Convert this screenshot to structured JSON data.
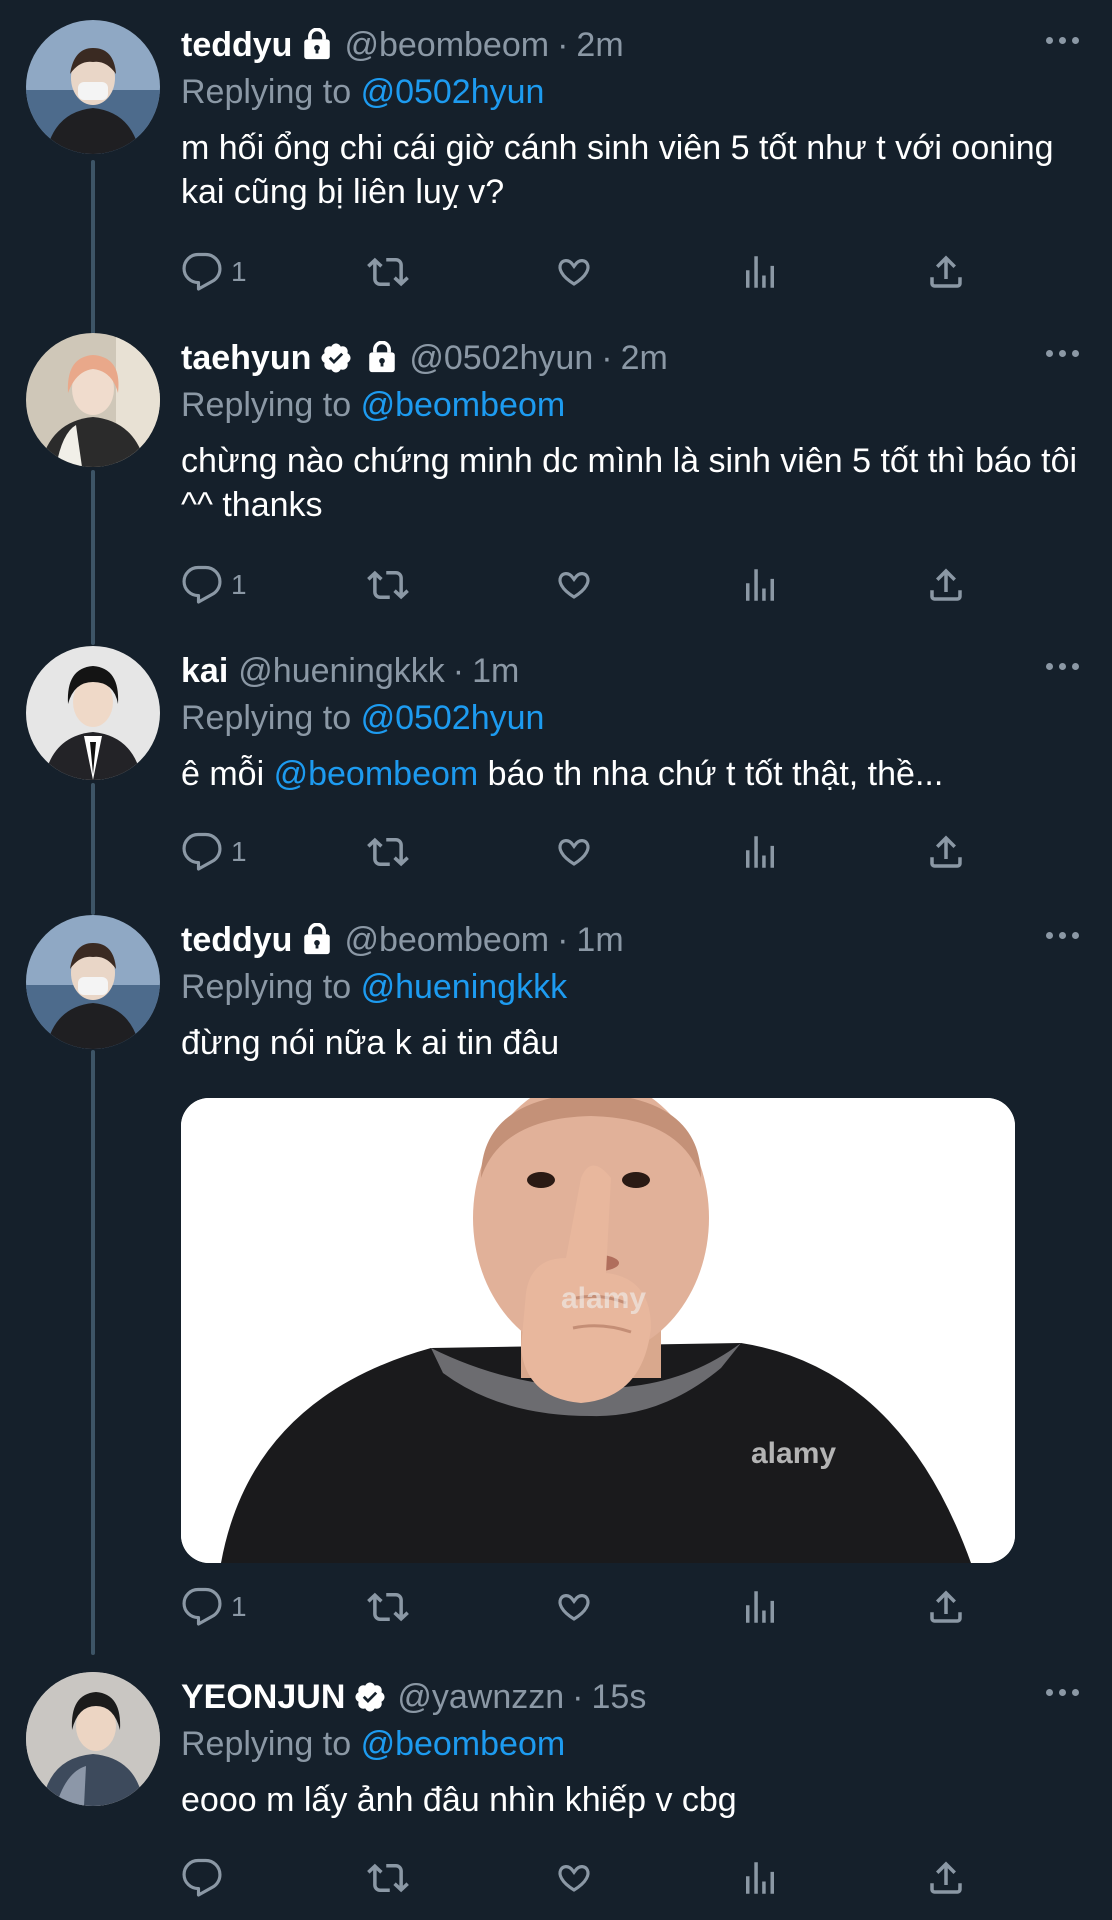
{
  "tweets": [
    {
      "name": "teddyu",
      "locked": true,
      "verified": false,
      "handle": "@beombeom",
      "sep": "·",
      "time": "2m",
      "replying_prefix": "Replying to",
      "replying_to": "@0502hyun",
      "text": "m hối ổng chi cái giờ cánh sinh viên 5 tốt như t với ooning kai cũng bị liên luỵ v?",
      "reply_count": "1"
    },
    {
      "name": "taehyun",
      "locked": true,
      "verified": true,
      "handle": "@0502hyun",
      "sep": "·",
      "time": "2m",
      "replying_prefix": "Replying to",
      "replying_to": "@beombeom",
      "text": "chừng nào chứng minh dc mình là sinh viên 5 tốt thì báo tôi ^^ thanks",
      "reply_count": "1"
    },
    {
      "name": "kai",
      "locked": false,
      "verified": false,
      "handle": "@hueningkkk",
      "sep": "·",
      "time": "1m",
      "replying_prefix": "Replying to",
      "replying_to": "@0502hyun",
      "text_prefix": "ê mỗi",
      "text_mention": "@beombeom",
      "text_suffix": "báo th nha chứ t tốt thật, thề...",
      "reply_count": "1"
    },
    {
      "name": "teddyu",
      "locked": true,
      "verified": false,
      "handle": "@beombeom",
      "sep": "·",
      "time": "1m",
      "replying_prefix": "Replying to",
      "replying_to": "@hueningkkk",
      "text": "đừng nói nữa k ai tin đâu",
      "reply_count": "1",
      "media_watermark": "alamy"
    },
    {
      "name": "YEONJUN",
      "locked": false,
      "verified": true,
      "handle": "@yawnzzn",
      "sep": "·",
      "time": "15s",
      "replying_prefix": "Replying to",
      "replying_to": "@beombeom",
      "text": "eooo m lấy ảnh đâu nhìn khiếp v cbg",
      "reply_count": ""
    }
  ],
  "colors": {
    "background": "#15202b",
    "secondary_text": "#8b98a5",
    "link": "#1d9bf0",
    "thread_line": "#3d5466"
  },
  "icons": [
    "reply-icon",
    "retweet-icon",
    "like-icon",
    "views-icon",
    "share-icon",
    "lock-icon",
    "verified-icon",
    "more-icon"
  ]
}
